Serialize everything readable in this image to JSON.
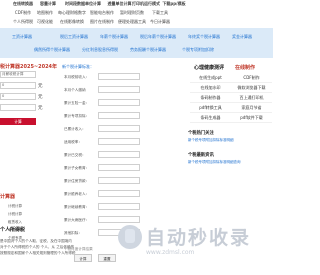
{
  "topnav": {
    "row1": [
      "在线转换器",
      "容量计算",
      "时间段数据单位计算",
      "透量单位计算",
      "打印机运行模式",
      "下载pp/模板"
    ],
    "row2": [
      "CDF制作",
      "地图制作",
      "每心理财格数字",
      "智能电台制作",
      "暂时理财页数",
      "下载工具"
    ],
    "row3": [
      "个人所得税",
      "可视化能",
      "在线影像转换",
      "图片在线制作",
      "便理处理器工具",
      "今日计算器"
    ]
  },
  "tabs": [
    "工资计算器",
    "税后工资计算器",
    "年薪个税计算器",
    "税后年薪个税计算器",
    "年终奖个税计算器",
    "奖金计算器"
  ],
  "tabs2": [
    "偶然所得个税计算器",
    "分红利息股息所得税",
    "劳务报酬个税计算器",
    "个税专项附加扣除"
  ],
  "left": {
    "title": "税计算器2025~2024年",
    "select_value": "月薪收税计算",
    "input1_value": "0",
    "unit1": "元",
    "input2_value": "0",
    "unit2": "元",
    "input3_value": "",
    "unit3": "元",
    "calc_button": "计算",
    "title2": "计算器",
    "list": [
      "计税计算",
      "计税计算",
      "租赁收入",
      "专项扣除",
      "个税专项"
    ],
    "foot_title": "个人所得税",
    "desc": [
      "是中国对个人的个人取，征税，及在中国境内",
      "对于个人所得税的个人的 个人，从 之后依赖的",
      "按照规定和国家个人相关规则管理的个人所得税"
    ]
  },
  "mid": {
    "title": "新个税计算标准：",
    "labels": [
      "本月税前收入：",
      "本月个人缴纳",
      "累计五险一金：",
      "累计专项扣除：",
      "已累计收入：",
      "适用税率：",
      "累计已交税：",
      "累计子女教育：",
      "累计住房贷款：",
      "累计赡养老人：",
      "累计继续教育：",
      "累计大病医疗：",
      "其他扣除："
    ],
    "note": "个税月度计算结果",
    "calc_button": "计算",
    "reset_button": "重置"
  },
  "right": {
    "head": "心理健康测评",
    "head2": "在线制作",
    "grid": [
      "在线生成ppt",
      "CDF制作",
      "在线加水印",
      "微软浏览器下载",
      "条码制作器",
      "百上通打印机",
      "pdf转换工具",
      "家庭月节省",
      "条码生成器",
      "pdf软件下载"
    ],
    "sub1": "个税热门关注",
    "link1": "新个税专项附加扣除标准明细",
    "sub2": "个税最新资讯",
    "link2": "新个税专项附加扣除标准明细查询"
  },
  "ad": {
    "title": "自动秒收录",
    "subtitle": "www.zdmsl.com"
  }
}
